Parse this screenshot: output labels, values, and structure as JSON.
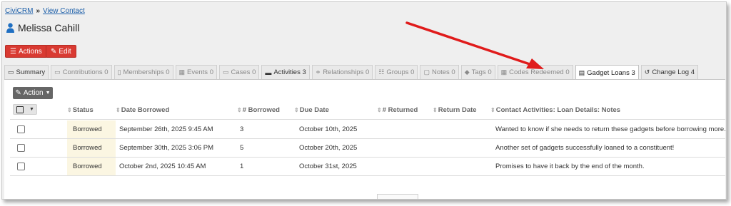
{
  "breadcrumb": {
    "home": "CiviCRM",
    "current": "View Contact"
  },
  "contact": {
    "name": "Melissa Cahill"
  },
  "actions": {
    "actions_label": "Actions",
    "edit_label": "Edit"
  },
  "tabs": [
    {
      "label": "Summary",
      "icon": "id-card-icon"
    },
    {
      "label": "Contributions 0",
      "icon": "credit-card-icon"
    },
    {
      "label": "Memberships 0",
      "icon": "id-badge-icon"
    },
    {
      "label": "Events 0",
      "icon": "calendar-icon"
    },
    {
      "label": "Cases 0",
      "icon": "folder-icon"
    },
    {
      "label": "Activities 3",
      "icon": "tasks-icon"
    },
    {
      "label": "Relationships 0",
      "icon": "handshake-icon"
    },
    {
      "label": "Groups 0",
      "icon": "users-icon"
    },
    {
      "label": "Notes 0",
      "icon": "note-icon"
    },
    {
      "label": "Tags 0",
      "icon": "tags-icon"
    },
    {
      "label": "Codes Redeemed 0",
      "icon": "grid-icon"
    },
    {
      "label": "Gadget Loans 3",
      "icon": "list-icon"
    },
    {
      "label": "Change Log 4",
      "icon": "history-icon"
    }
  ],
  "table": {
    "action_label": "Action",
    "headers": [
      "Status",
      "Date Borrowed",
      "# Borrowed",
      "Due Date",
      "# Returned",
      "Return Date",
      "Contact Activities: Loan Details: Notes"
    ],
    "rows": [
      {
        "status": "Borrowed",
        "date_borrowed": "September 26th, 2025 9:45 AM",
        "num_borrowed": "3",
        "due_date": "October 10th, 2025",
        "num_returned": "",
        "return_date": "",
        "notes": "Wanted to know if she needs to return these gadgets before borrowing more."
      },
      {
        "status": "Borrowed",
        "date_borrowed": "September 30th, 2025 3:06 PM",
        "num_borrowed": "5",
        "due_date": "October 20th, 2025",
        "num_returned": "",
        "return_date": "",
        "notes": "Another set of gadgets successfully loaned to a constituent!"
      },
      {
        "status": "Borrowed",
        "date_borrowed": "October 2nd, 2025 10:45 AM",
        "num_borrowed": "1",
        "due_date": "October 31st, 2025",
        "num_returned": "",
        "return_date": "",
        "notes": "Promises to have it back by the end of the month."
      }
    ]
  },
  "colors": {
    "accent_red": "#d93a32",
    "link_blue": "#1b5ea8",
    "annotation_arrow": "#e01b1b",
    "status_bg": "#fbf6e2"
  }
}
